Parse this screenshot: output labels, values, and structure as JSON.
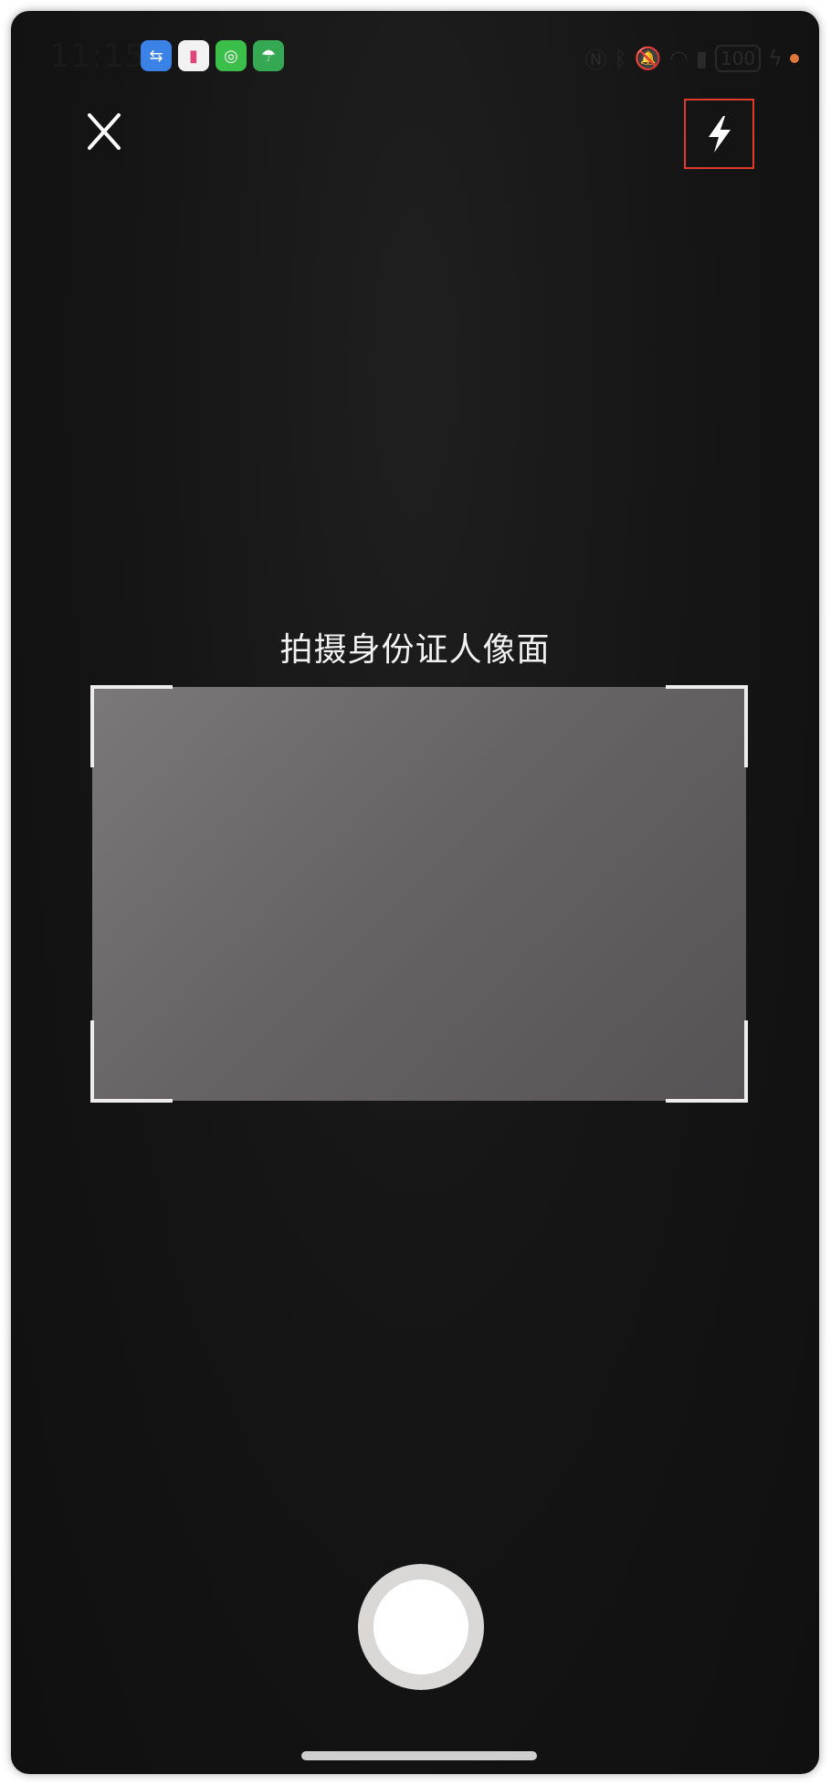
{
  "status_bar": {
    "time": "11:15",
    "battery": "100",
    "app_icons": [
      {
        "name": "usb-icon",
        "color": "#3b82e6",
        "glyph": "⇆"
      },
      {
        "name": "book-app-icon",
        "color": "#f2f2f2",
        "glyph": "▮"
      },
      {
        "name": "wechat-icon",
        "color": "#3cbf4a",
        "glyph": "◎"
      },
      {
        "name": "umbrella-app-icon",
        "color": "#34a853",
        "glyph": "☂"
      }
    ],
    "indicator_dot_color": "#e0783a"
  },
  "camera": {
    "title": "拍摄身份证人像面",
    "flash_highlight_color": "#e03a2b"
  }
}
